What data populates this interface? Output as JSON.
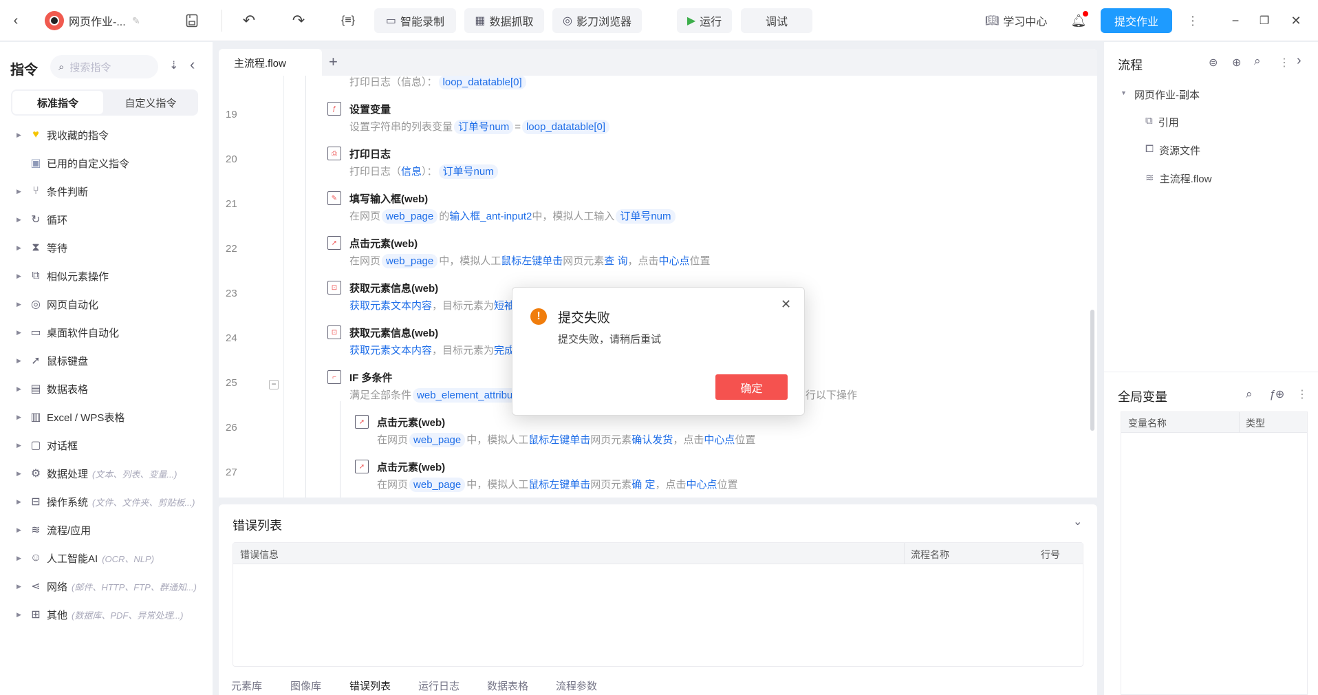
{
  "topbar": {
    "project_title": "网页作业-...",
    "record_label": "智能录制",
    "capture_label": "数据抓取",
    "browser_label": "影刀浏览器",
    "run_label": "运行",
    "debug_label": "调试",
    "learn_label": "学习中心",
    "submit_label": "提交作业",
    "accent": "#1e9bff"
  },
  "sidebar": {
    "title": "指令",
    "search_placeholder": "搜索指令",
    "tabs": [
      "标准指令",
      "自定义指令"
    ],
    "items": [
      {
        "label": "我收藏的指令",
        "hint": "",
        "icon": "heart-icon",
        "arrow": true
      },
      {
        "label": "已用的自定义指令",
        "hint": "",
        "icon": "calendar-check-icon",
        "arrow": false
      },
      {
        "label": "条件判断",
        "hint": "",
        "icon": "branch-icon",
        "arrow": true
      },
      {
        "label": "循环",
        "hint": "",
        "icon": "loop-icon",
        "arrow": true
      },
      {
        "label": "等待",
        "hint": "",
        "icon": "hourglass-icon",
        "arrow": true
      },
      {
        "label": "相似元素操作",
        "hint": "",
        "icon": "copy-icon",
        "arrow": true
      },
      {
        "label": "网页自动化",
        "hint": "",
        "icon": "browser-icon",
        "arrow": true
      },
      {
        "label": "桌面软件自动化",
        "hint": "",
        "icon": "monitor-icon",
        "arrow": true
      },
      {
        "label": "鼠标键盘",
        "hint": "",
        "icon": "cursor-icon",
        "arrow": true
      },
      {
        "label": "数据表格",
        "hint": "",
        "icon": "document-icon",
        "arrow": true
      },
      {
        "label": "Excel / WPS表格",
        "hint": "",
        "icon": "excel-icon",
        "arrow": true
      },
      {
        "label": "对话框",
        "hint": "",
        "icon": "dialog-icon",
        "arrow": true
      },
      {
        "label": "数据处理",
        "hint": "(文本、列表、变量...)",
        "icon": "data-process-icon",
        "arrow": true
      },
      {
        "label": "操作系统",
        "hint": "(文件、文件夹、剪贴板...)",
        "icon": "briefcase-icon",
        "arrow": true
      },
      {
        "label": "流程/应用",
        "hint": "",
        "icon": "layers-icon",
        "arrow": true
      },
      {
        "label": "人工智能AI",
        "hint": "(OCR、NLP)",
        "icon": "ai-icon",
        "arrow": true
      },
      {
        "label": "网络",
        "hint": "(邮件、HTTP、FTP、群通知...)",
        "icon": "share-icon",
        "arrow": true
      },
      {
        "label": "其他",
        "hint": "(数据库、PDF、异常处理...)",
        "icon": "grid-icon",
        "arrow": true
      }
    ]
  },
  "editor": {
    "tab_label": "主流程.flow",
    "rows": [
      {
        "num": "",
        "title": "",
        "nested": false,
        "icon": "print-icon",
        "desc": [
          {
            "t": "打印日志（信息）：",
            "k": "plain"
          },
          {
            "t": "loop_datatable[0]",
            "k": "chip"
          }
        ]
      },
      {
        "num": "19",
        "title": "设置变量",
        "nested": false,
        "icon": "variable-icon",
        "desc": [
          {
            "t": "设置字符串的列表变量",
            "k": "plain"
          },
          {
            "t": "订单号num",
            "k": "chip"
          },
          {
            "t": "=",
            "k": "plain"
          },
          {
            "t": "loop_datatable[0]",
            "k": "chip"
          }
        ]
      },
      {
        "num": "20",
        "title": "打印日志",
        "nested": false,
        "icon": "print-icon",
        "desc": [
          {
            "t": "打印日志（",
            "k": "plain"
          },
          {
            "t": "信息",
            "k": "link"
          },
          {
            "t": "）：",
            "k": "plain"
          },
          {
            "t": "订单号num",
            "k": "chip"
          }
        ]
      },
      {
        "num": "21",
        "title": "填写输入框(web)",
        "nested": false,
        "icon": "input-icon",
        "desc": [
          {
            "t": "在网页",
            "k": "plain"
          },
          {
            "t": "web_page",
            "k": "chip"
          },
          {
            "t": "的",
            "k": "plain"
          },
          {
            "t": "输入框_ant-input2",
            "k": "link"
          },
          {
            "t": "中，模拟人工输入",
            "k": "plain"
          },
          {
            "t": "订单号num",
            "k": "chip"
          }
        ]
      },
      {
        "num": "22",
        "title": "点击元素(web)",
        "nested": false,
        "icon": "click-icon",
        "desc": [
          {
            "t": "在网页",
            "k": "plain"
          },
          {
            "t": "web_page",
            "k": "chip"
          },
          {
            "t": "中，模拟人工",
            "k": "plain"
          },
          {
            "t": "鼠标左键单击",
            "k": "link"
          },
          {
            "t": "网页元素",
            "k": "plain"
          },
          {
            "t": "查 询",
            "k": "link"
          },
          {
            "t": "，点击",
            "k": "plain"
          },
          {
            "t": "中心点",
            "k": "link"
          },
          {
            "t": "位置",
            "k": "plain"
          }
        ]
      },
      {
        "num": "23",
        "title": "获取元素信息(web)",
        "nested": false,
        "icon": "element-info-icon",
        "desc": [
          {
            "t": "获取元素文本内容",
            "k": "link"
          },
          {
            "t": "，目标元素为",
            "k": "plain"
          },
          {
            "t": "短袖",
            "k": "link"
          }
        ]
      },
      {
        "num": "24",
        "title": "获取元素信息(web)",
        "nested": false,
        "icon": "element-info-icon",
        "desc": [
          {
            "t": "获取元素文本内容",
            "k": "link"
          },
          {
            "t": "，目标元素为",
            "k": "plain"
          },
          {
            "t": "完成",
            "k": "link"
          }
        ]
      },
      {
        "num": "25",
        "title": "IF 多条件",
        "nested": false,
        "icon": "if-icon",
        "collapse": true,
        "desc": [
          {
            "t": "满足全部条件",
            "k": "plain"
          },
          {
            "t": "web_element_attribute",
            "k": "chip"
          }
        ],
        "tail": "行以下操作"
      },
      {
        "num": "26",
        "title": "点击元素(web)",
        "nested": true,
        "icon": "click-icon",
        "desc": [
          {
            "t": "在网页",
            "k": "plain"
          },
          {
            "t": "web_page",
            "k": "chip"
          },
          {
            "t": "中，模拟人工",
            "k": "plain"
          },
          {
            "t": "鼠标左键单击",
            "k": "link"
          },
          {
            "t": "网页元素",
            "k": "plain"
          },
          {
            "t": "确认发货",
            "k": "link"
          },
          {
            "t": "，点击",
            "k": "plain"
          },
          {
            "t": "中心点",
            "k": "link"
          },
          {
            "t": "位置",
            "k": "plain"
          }
        ]
      },
      {
        "num": "27",
        "title": "点击元素(web)",
        "nested": true,
        "icon": "click-icon",
        "desc": [
          {
            "t": "在网页",
            "k": "plain"
          },
          {
            "t": "web_page",
            "k": "chip"
          },
          {
            "t": "中，模拟人工",
            "k": "plain"
          },
          {
            "t": "鼠标左键单击",
            "k": "link"
          },
          {
            "t": "网页元素",
            "k": "plain"
          },
          {
            "t": "确 定",
            "k": "link"
          },
          {
            "t": "，点击",
            "k": "plain"
          },
          {
            "t": "中心点",
            "k": "link"
          },
          {
            "t": "位置",
            "k": "plain"
          }
        ]
      }
    ]
  },
  "bottom": {
    "title": "错误列表",
    "columns": [
      "错误信息",
      "流程名称",
      "行号"
    ],
    "tabs": [
      "元素库",
      "图像库",
      "错误列表",
      "运行日志",
      "数据表格",
      "流程参数"
    ],
    "active_tab": 2
  },
  "right": {
    "flow_title": "流程",
    "project": "网页作业-副本",
    "tree": [
      {
        "label": "引用",
        "icon": "reference-icon"
      },
      {
        "label": "资源文件",
        "icon": "puzzle-icon"
      },
      {
        "label": "主流程.flow",
        "icon": "layers-icon"
      }
    ],
    "vars_title": "全局变量",
    "var_columns": [
      "变量名称",
      "类型"
    ]
  },
  "dialog": {
    "title": "提交失败",
    "message": "提交失败，请稍后重试",
    "ok_label": "确定",
    "ok_color": "#f5524f",
    "icon_color": "#f07d0c"
  }
}
